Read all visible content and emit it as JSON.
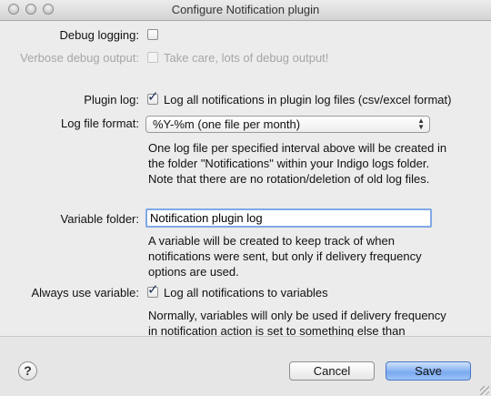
{
  "window": {
    "title": "Configure Notification plugin"
  },
  "debug_logging": {
    "label": "Debug logging:",
    "checked": false
  },
  "verbose_debug": {
    "label": "Verbose debug output:",
    "text": "Take care, lots of debug output!",
    "checked": false,
    "enabled": false
  },
  "plugin_log": {
    "label": "Plugin log:",
    "text": "Log all notifications in plugin log files (csv/excel format)",
    "checked": true,
    "check_glyph": "✓"
  },
  "log_file_format": {
    "label": "Log file format:",
    "selected": "%Y-%m (one file per month)",
    "arrows_icon": "▲▼",
    "help_lines": [
      "One log file per specified interval above will be created in",
      "the folder \"Notifications\" within your Indigo logs folder.",
      "Note that there are no rotation/deletion of old log files."
    ]
  },
  "variable_folder": {
    "label": "Variable folder:",
    "value": "Notification plugin log",
    "help_lines": [
      "A variable will be created to keep track of when",
      "notifications were sent, but only if delivery frequency",
      "options are used."
    ]
  },
  "always_use_variable": {
    "label": "Always use variable:",
    "text": "Log all notifications to variables",
    "checked": true,
    "check_glyph": "✓",
    "help_lines": [
      "Normally, variables will only be used if delivery frequency",
      "in notification action is set to something else than"
    ]
  },
  "footer": {
    "help_label": "?",
    "cancel_label": "Cancel",
    "save_label": "Save"
  }
}
